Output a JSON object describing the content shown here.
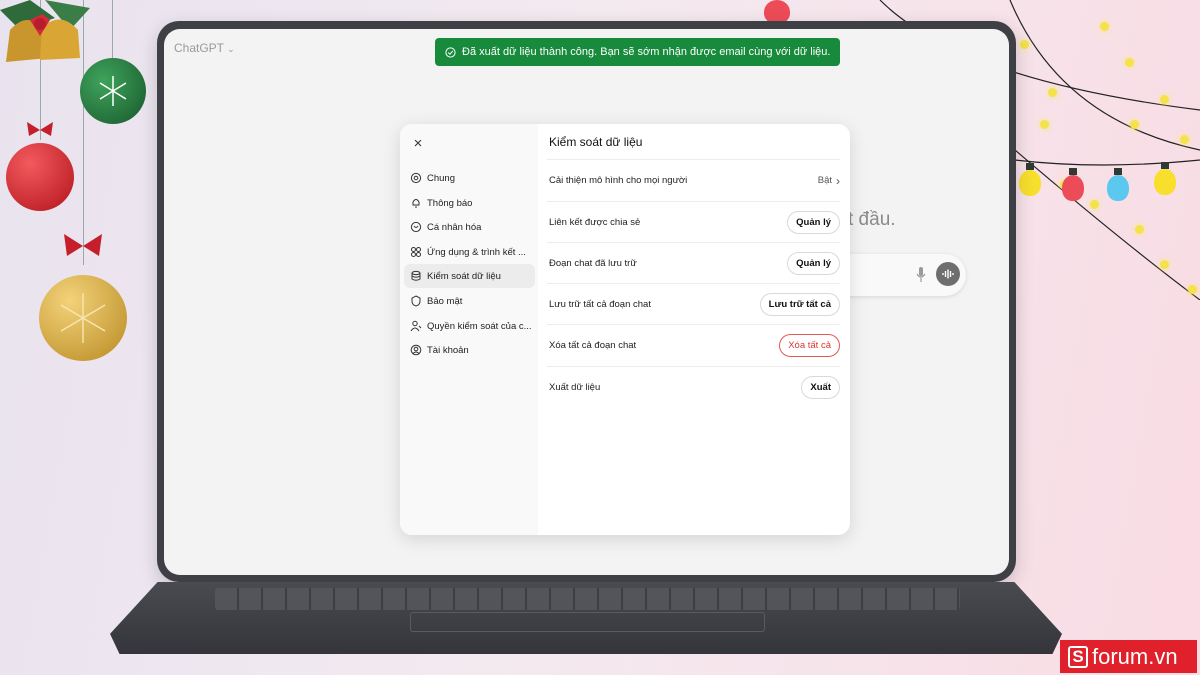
{
  "app": {
    "title": "ChatGPT",
    "background_hint": "t đầu."
  },
  "toast": {
    "message": "Đã xuất dữ liệu thành công. Bạn sẽ sớm nhận được email cùng với dữ liệu.",
    "color": "#178a3c"
  },
  "dialog": {
    "close_label": "×",
    "title": "Kiểm soát dữ liệu",
    "nav": [
      {
        "label": "Chung",
        "icon": "gear-icon"
      },
      {
        "label": "Thông báo",
        "icon": "bell-icon"
      },
      {
        "label": "Cá nhân hóa",
        "icon": "personalization-icon"
      },
      {
        "label": "Ứng dụng & trình kết ...",
        "icon": "apps-icon"
      },
      {
        "label": "Kiểm soát dữ liệu",
        "icon": "database-icon",
        "active": true
      },
      {
        "label": "Bảo mật",
        "icon": "security-icon"
      },
      {
        "label": "Quyền kiểm soát của c...",
        "icon": "parental-control-icon"
      },
      {
        "label": "Tài khoản",
        "icon": "account-icon"
      }
    ],
    "rows": [
      {
        "label": "Cải thiện mô hình cho mọi người",
        "value": "Bật"
      },
      {
        "label": "Liên kết được chia sẻ",
        "button": "Quản lý"
      },
      {
        "label": "Đoạn chat đã lưu trữ",
        "button": "Quản lý"
      },
      {
        "label": "Lưu trữ tất cả đoạn chat",
        "button": "Lưu trữ tất cả"
      },
      {
        "label": "Xóa tất cả đoạn chat",
        "button": "Xóa tất cả",
        "danger": true
      },
      {
        "label": "Xuất dữ liệu",
        "button": "Xuất"
      }
    ]
  },
  "brand": {
    "name": "forum.vn",
    "mark": "S",
    "color": "#e0202a"
  }
}
